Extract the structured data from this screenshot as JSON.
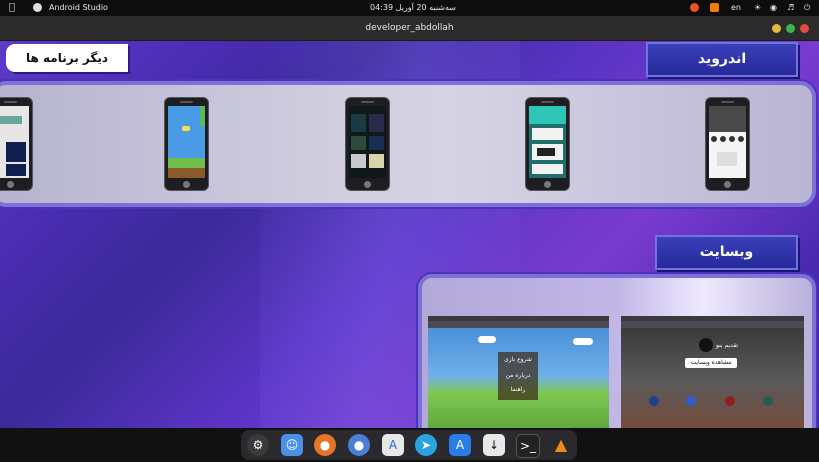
{
  "topbar": {
    "app_name": "Android Studio",
    "clock": "سه‌شنبه 20 آوریل  04:39",
    "lang": "en"
  },
  "window": {
    "title": "developer_abdollah"
  },
  "page": {
    "other_apps_label": "دیگر برنامه ها",
    "android_tab": "اندروید",
    "website_tab": "وبسایت"
  },
  "website_preview_2": {
    "caption_name": "تقدیم بنو",
    "caption_button": "مشاهده وبسایت"
  },
  "website_preview_1": {
    "menu_items": [
      "شروع بازی",
      "درباره من",
      "راهنما"
    ]
  },
  "dock": {
    "icons": [
      "settings-icon",
      "finder-icon",
      "firefox-icon",
      "chromium-icon",
      "android-studio-icon",
      "telegram-icon",
      "app-store-icon",
      "download-icon",
      "terminal-icon",
      "vlc-icon"
    ]
  },
  "colors": {
    "accent": "#5e39c9",
    "tab_blue": "#2c2fa6",
    "panel_border": "#7f6fd8"
  }
}
